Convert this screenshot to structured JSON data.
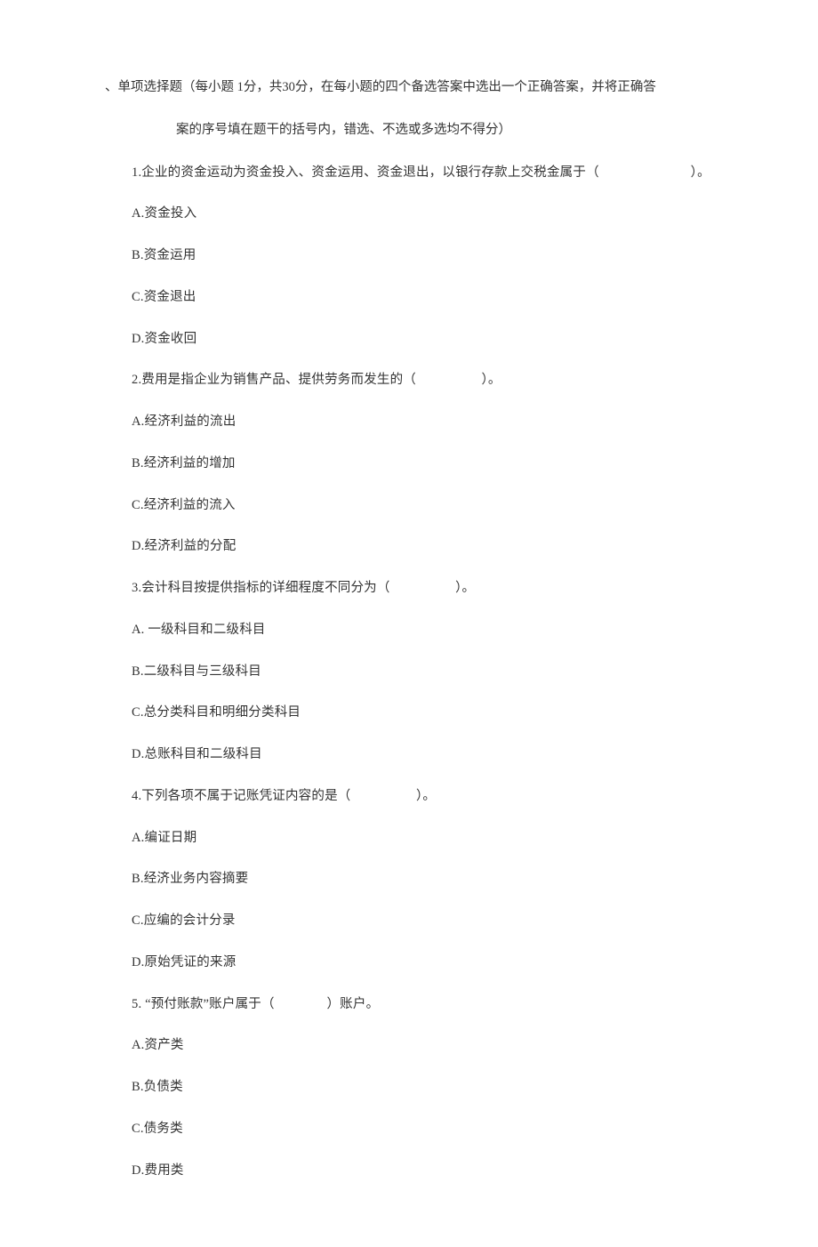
{
  "section": {
    "header_line1": "、单项选择题（每小题 1分，共30分，在每小题的四个备选答案中选出一个正确答案，并将正确答",
    "header_line2": "案的序号填在题干的括号内，错选、不选或多选均不得分）"
  },
  "questions": [
    {
      "stem": "1.企业的资金运动为资金投入、资金运用、资金退出，以银行存款上交税金属于（　　　　　　　）。",
      "options": {
        "A": "A.资金投入",
        "B": "B.资金运用",
        "C": "C.资金退出",
        "D": "D.资金收回"
      }
    },
    {
      "stem": "2.费用是指企业为销售产品、提供劳务而发生的（　　　　　）。",
      "options": {
        "A": "A.经济利益的流出",
        "B": "B.经济利益的增加",
        "C": "C.经济利益的流入",
        "D": "D.经济利益的分配"
      }
    },
    {
      "stem": "3.会计科目按提供指标的详细程度不同分为（　　　　　）。",
      "options": {
        "A": "A. 一级科目和二级科目",
        "B": "B.二级科目与三级科目",
        "C": "C.总分类科目和明细分类科目",
        "D": "D.总账科目和二级科目"
      }
    },
    {
      "stem": "4.下列各项不属于记账凭证内容的是（　　　　　）。",
      "options": {
        "A": "A.编证日期",
        "B": "B.经济业务内容摘要",
        "C": "C.应编的会计分录",
        "D": "D.原始凭证的来源"
      }
    },
    {
      "stem": "5. “预付账款”账户属于（　　　　）账户。",
      "options": {
        "A": "A.资产类",
        "B": "B.负债类",
        "C": "C.债务类",
        "D": "D.费用类"
      }
    }
  ]
}
